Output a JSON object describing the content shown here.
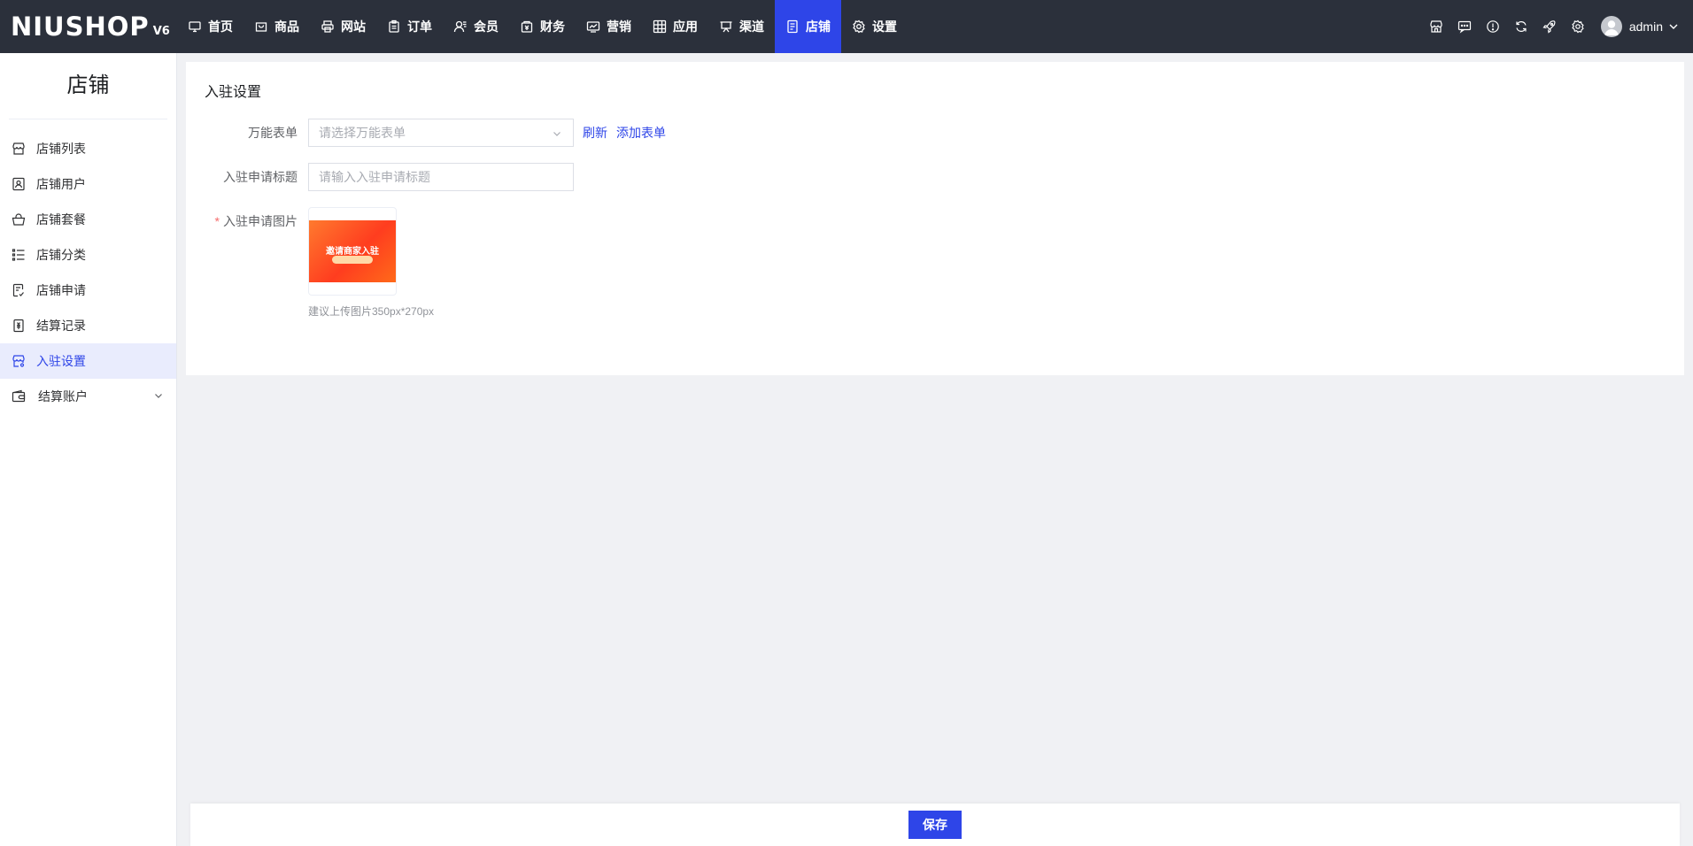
{
  "header": {
    "logo": "NIUSHOP",
    "version": "V6",
    "nav": [
      {
        "label": "首页",
        "icon": "monitor-icon"
      },
      {
        "label": "商品",
        "icon": "goods-box-icon"
      },
      {
        "label": "网站",
        "icon": "printer-icon"
      },
      {
        "label": "订单",
        "icon": "clipboard-icon"
      },
      {
        "label": "会员",
        "icon": "member-icon"
      },
      {
        "label": "财务",
        "icon": "finance-icon"
      },
      {
        "label": "营销",
        "icon": "marketing-chart-icon"
      },
      {
        "label": "应用",
        "icon": "app-grid-icon"
      },
      {
        "label": "渠道",
        "icon": "channel-icon"
      },
      {
        "label": "店铺",
        "icon": "store-doc-icon",
        "active": true
      },
      {
        "label": "设置",
        "icon": "gear-icon"
      }
    ],
    "tools": [
      "shop-icon",
      "message-icon",
      "info-icon",
      "refresh-icon",
      "rocket-icon",
      "settings-icon"
    ],
    "user": "admin"
  },
  "sidebar": {
    "title": "店铺",
    "items": [
      {
        "label": "店铺列表",
        "icon": "store-list-icon"
      },
      {
        "label": "店铺用户",
        "icon": "store-user-icon"
      },
      {
        "label": "店铺套餐",
        "icon": "basket-icon"
      },
      {
        "label": "店铺分类",
        "icon": "category-list-icon"
      },
      {
        "label": "店铺申请",
        "icon": "apply-doc-icon"
      },
      {
        "label": "结算记录",
        "icon": "settle-record-icon"
      },
      {
        "label": "入驻设置",
        "icon": "entry-settings-icon",
        "active": true
      },
      {
        "label": "结算账户",
        "icon": "wallet-icon",
        "expandable": true
      }
    ]
  },
  "main": {
    "title": "入驻设置",
    "form": {
      "form_label": "万能表单",
      "form_placeholder": "请选择万能表单",
      "refresh_label": "刷新",
      "add_form_label": "添加表单",
      "apply_title_label": "入驻申请标题",
      "apply_title_placeholder": "请输入入驻申请标题",
      "apply_image_label": "入驻申请图片",
      "banner_text": "邀请商家入驻",
      "image_hint": "建议上传图片350px*270px"
    }
  },
  "footer": {
    "save_label": "保存"
  },
  "colors": {
    "accent": "#2e45e8",
    "topbar_bg": "#2b303b",
    "required": "#f56c6c"
  }
}
